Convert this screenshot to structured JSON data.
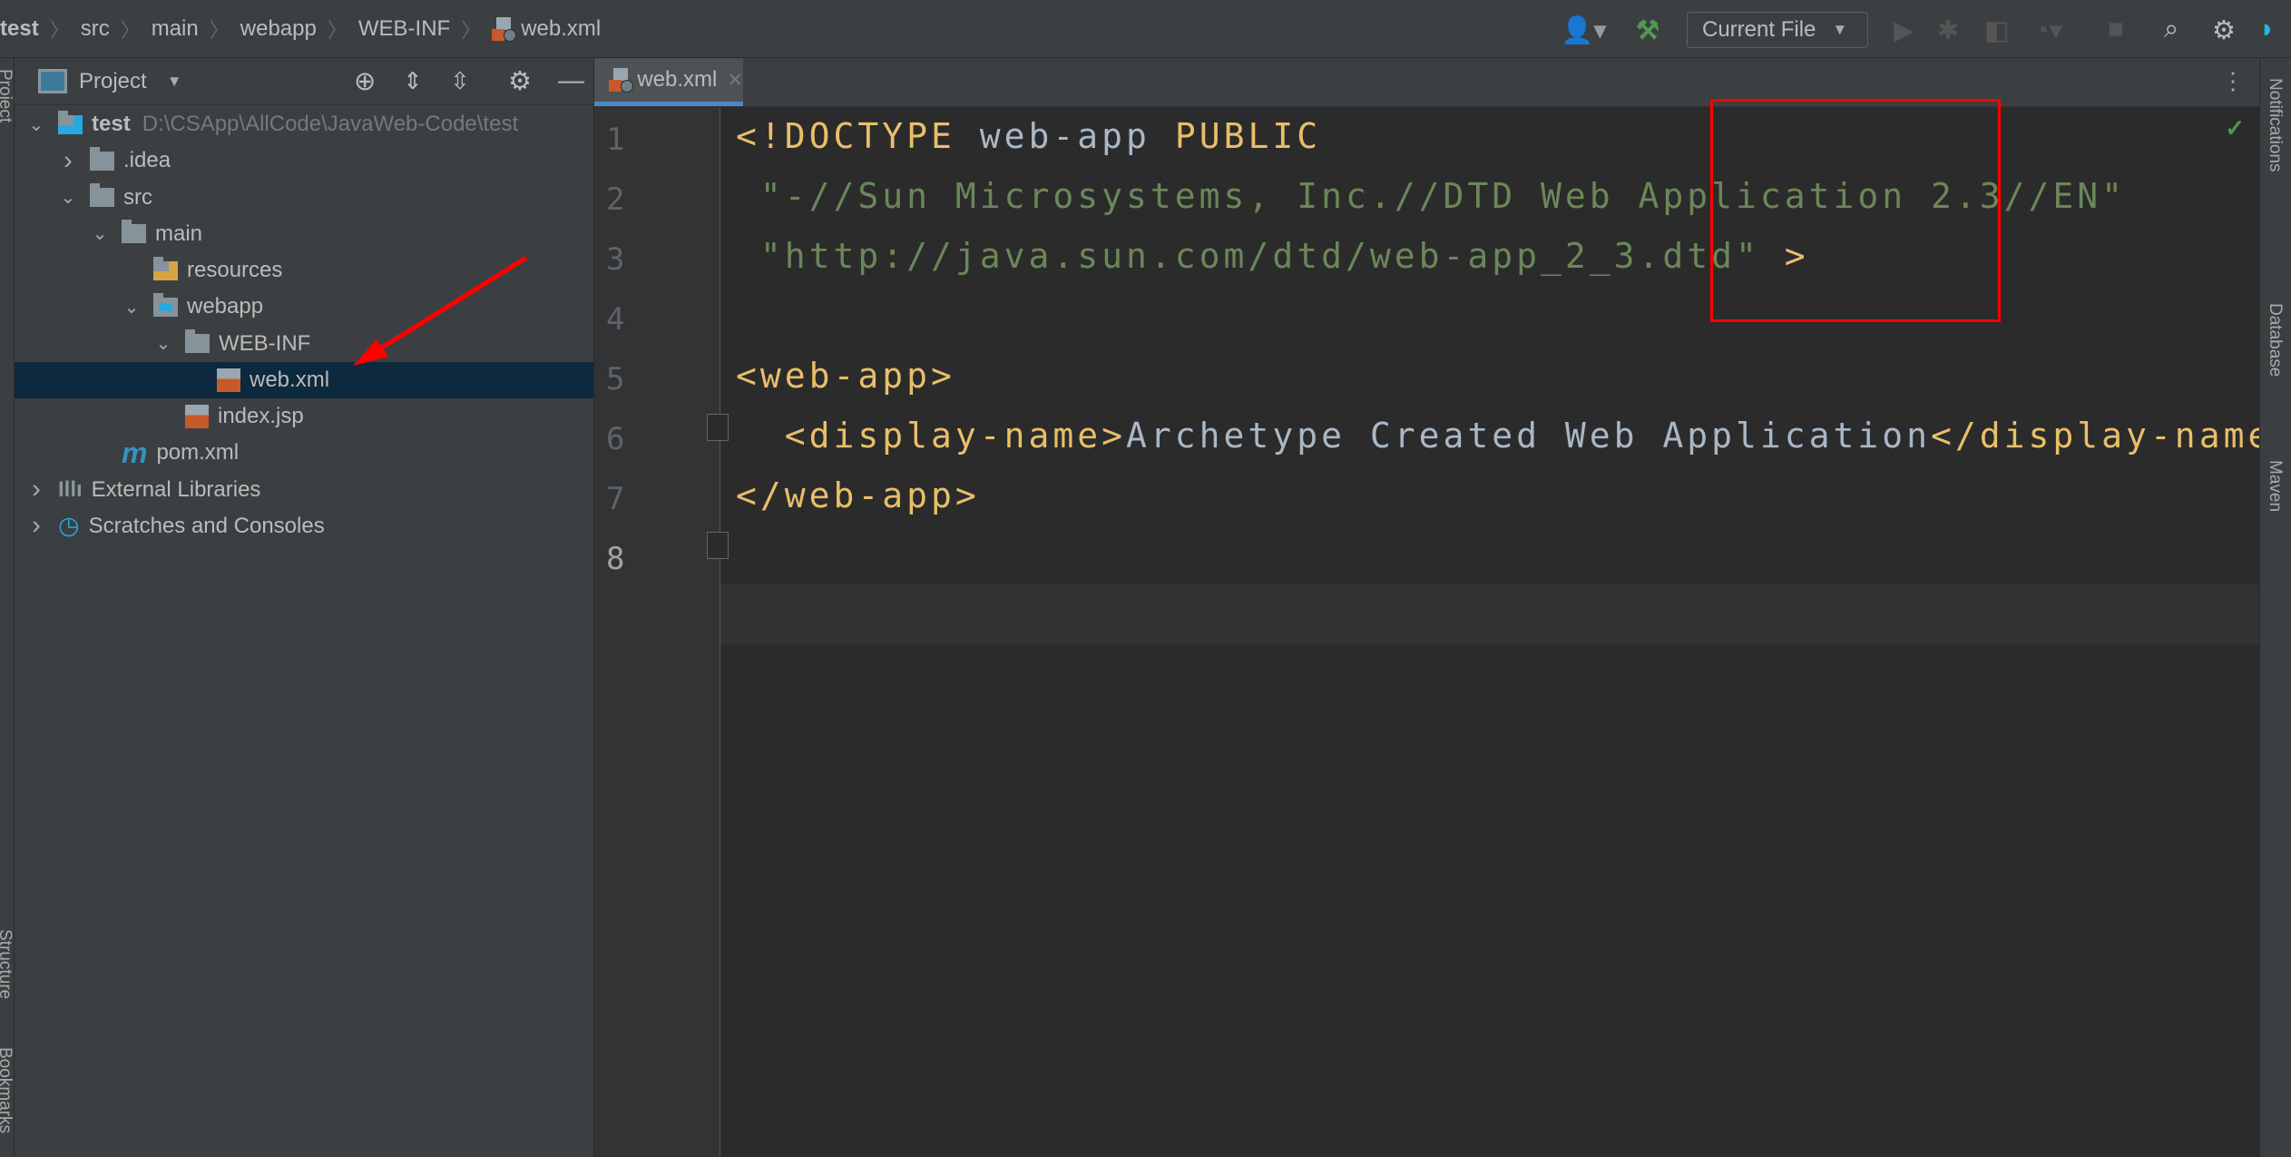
{
  "breadcrumb": [
    "test",
    "src",
    "main",
    "webapp",
    "WEB-INF",
    "web.xml"
  ],
  "toolbar": {
    "run_config": "Current File"
  },
  "project_panel": {
    "title": "Project",
    "tree": [
      {
        "label": "test",
        "path": "D:\\CSApp\\AllCode\\JavaWeb-Code\\test",
        "depth": 0,
        "expanded": true,
        "icon": "module-folder-icon"
      },
      {
        "label": ".idea",
        "depth": 1,
        "expanded": false,
        "icon": "folder-icon"
      },
      {
        "label": "src",
        "depth": 1,
        "expanded": true,
        "icon": "folder-icon"
      },
      {
        "label": "main",
        "depth": 2,
        "expanded": true,
        "icon": "folder-icon"
      },
      {
        "label": "resources",
        "depth": 3,
        "icon": "resources-folder-icon"
      },
      {
        "label": "webapp",
        "depth": 3,
        "expanded": true,
        "icon": "web-folder-icon"
      },
      {
        "label": "WEB-INF",
        "depth": 4,
        "expanded": true,
        "icon": "folder-icon"
      },
      {
        "label": "web.xml",
        "depth": 5,
        "selected": true,
        "icon": "xml-file-icon"
      },
      {
        "label": "index.jsp",
        "depth": 4,
        "icon": "jsp-file-icon"
      },
      {
        "label": "pom.xml",
        "depth": 2,
        "icon": "maven-icon"
      },
      {
        "label": "External Libraries",
        "depth": 0,
        "expanded": false,
        "icon": "libraries-icon"
      },
      {
        "label": "Scratches and Consoles",
        "depth": 0,
        "expanded": false,
        "icon": "scratches-icon"
      }
    ]
  },
  "left_strip": {
    "project": "Project",
    "structure": "Structure",
    "bookmarks": "Bookmarks"
  },
  "editor": {
    "tab": "web.xml",
    "line_numbers": [
      "1",
      "2",
      "3",
      "4",
      "5",
      "6",
      "7",
      "8"
    ],
    "lines": {
      "l1a": "<!DOCTYPE ",
      "l1b": "web-app ",
      "l1c": "PUBLIC",
      "l2": " \"-//Sun Microsystems, Inc.//DTD Web Application 2.3//EN\"",
      "l3a": " \"http://java.sun.com/dtd/web-app_2_3.dtd\"",
      "l3b": " >",
      "l5": "<web-app>",
      "l6a": "  <display-name>",
      "l6b": "Archetype Created Web Application",
      "l6c": "</display-name>",
      "l7": "</web-app>"
    }
  },
  "right_strip": {
    "notifications": "Notifications",
    "database": "Database",
    "maven": "Maven"
  },
  "colors": {
    "accent": "#4a88c7",
    "selection": "#0d293e",
    "annotation": "#ff0000",
    "xml_tag": "#e8bf6a",
    "string": "#6a8759"
  }
}
